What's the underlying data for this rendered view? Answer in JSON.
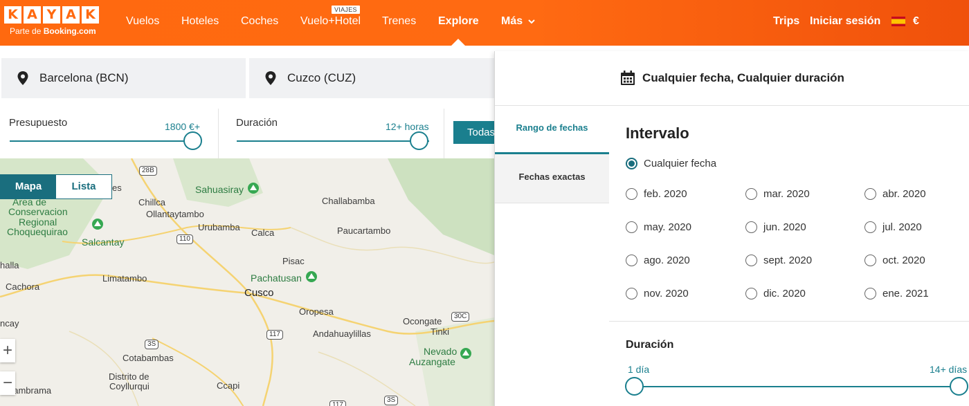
{
  "brand": {
    "logo_letters": [
      "K",
      "A",
      "Y",
      "A",
      "K"
    ],
    "sub_prefix": "Parte de ",
    "sub_brand": "Booking.com",
    "color": "#ff690f"
  },
  "nav": {
    "items": [
      {
        "label": "Vuelos"
      },
      {
        "label": "Hoteles"
      },
      {
        "label": "Coches"
      },
      {
        "label": "Vuelo+Hotel",
        "badge": "VIAJES"
      },
      {
        "label": "Trenes"
      },
      {
        "label": "Explore",
        "active": true
      },
      {
        "label": "Más",
        "icon": "chevron-down-icon"
      }
    ],
    "right": {
      "trips": "Trips",
      "login": "Iniciar sesión",
      "flag_icon": "spain-flag-icon",
      "currency": "€"
    }
  },
  "search": {
    "origin": "Barcelona (BCN)",
    "destination": "Cuzco (CUZ)",
    "pin_icon": "location-pin-icon"
  },
  "filters": {
    "budget": {
      "label": "Presupuesto",
      "value": "1800 €+",
      "level": 1.0
    },
    "duration": {
      "label": "Duración",
      "value": "12+ horas",
      "level": 1.0
    },
    "stops_button": "Todas"
  },
  "map": {
    "view_toggle": {
      "map": "Mapa",
      "list": "Lista",
      "selected": "Mapa"
    },
    "zoom_in": "+",
    "zoom_out": "−",
    "labels": {
      "es": "es",
      "area1": "Area de",
      "area2": "Conservacion",
      "area3": "Regional",
      "area4": "Choquequirao",
      "chillca": "Chillca",
      "ollantaytambo": "Ollantaytambo",
      "urubamba": "Urubamba",
      "calca": "Calca",
      "sahuasiray": "Sahuasiray",
      "challabamba": "Challabamba",
      "paucartambo": "Paucartambo",
      "salcantay": "Salcantay",
      "halla": "halla",
      "pisac": "Pisac",
      "pachatusan": "Pachatusan",
      "limatambo": "Limatambo",
      "cachora": "Cachora",
      "cusco": "Cusco",
      "oropesa": "Oropesa",
      "ocongate": "Ocongate",
      "tinki": "Tinki",
      "ncay": "ncay",
      "andahuaylillas": "Andahuaylillas",
      "nevado1": "Nevado",
      "nevado2": "Auzangate",
      "cotabambas": "Cotabambas",
      "distrito1": "Distrito de",
      "distrito2": "Coyllurqui",
      "ccapi": "Ccapi",
      "lambrama": "Lambrama"
    },
    "shields": {
      "r28b": "28B",
      "r110": "110",
      "r117a": "117",
      "r30c": "30C",
      "r3s_a": "3S",
      "r3s_b": "3S",
      "r117b": "117"
    }
  },
  "date_panel": {
    "header_icon": "calendar-icon",
    "header": "Cualquier fecha, Cualquier duración",
    "tabs": [
      {
        "label": "Rango de fechas",
        "active": true
      },
      {
        "label": "Fechas exactas",
        "active": false
      }
    ],
    "interval_title": "Intervalo",
    "any_date": "Cualquier fecha",
    "months": [
      "feb. 2020",
      "mar. 2020",
      "abr. 2020",
      "may. 2020",
      "jun. 2020",
      "jul. 2020",
      "ago. 2020",
      "sept. 2020",
      "oct. 2020",
      "nov. 2020",
      "dic. 2020",
      "ene. 2021"
    ],
    "selected": "Cualquier fecha",
    "duration_title": "Duración",
    "duration_min": "1 día",
    "duration_max": "14+ días",
    "accent": "#1a7f8e"
  }
}
